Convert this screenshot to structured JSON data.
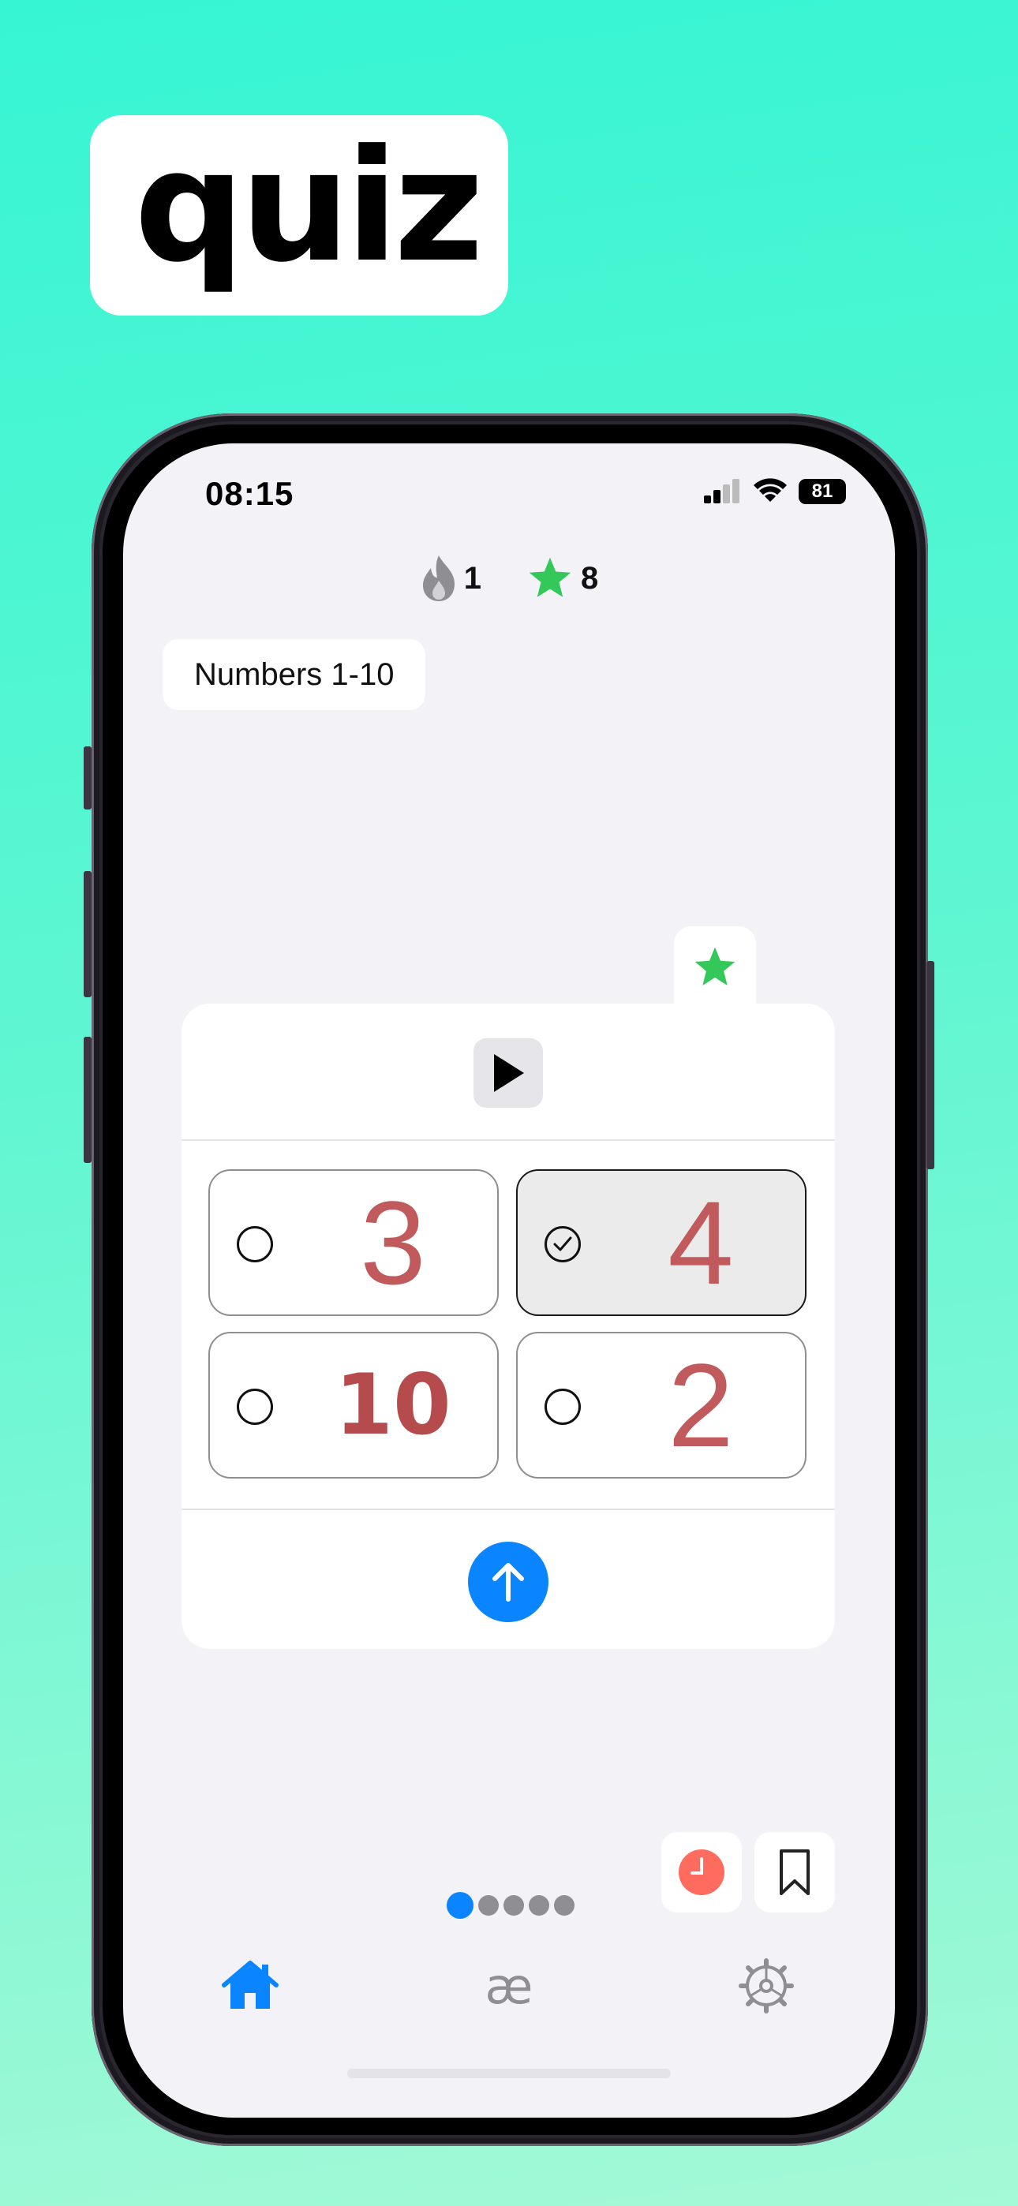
{
  "promo": {
    "title": "quiz"
  },
  "status_bar": {
    "time": "08:15",
    "battery": "81"
  },
  "stats": {
    "streak": "1",
    "stars": "8"
  },
  "deck": {
    "name": "Numbers 1-10"
  },
  "quiz": {
    "options": [
      {
        "label": "3",
        "selected": false
      },
      {
        "label": "4",
        "selected": true
      },
      {
        "label": "10",
        "selected": false
      },
      {
        "label": "2",
        "selected": false
      }
    ]
  },
  "pager": {
    "total": 5,
    "current": 1
  },
  "tab_bar": {
    "items": [
      {
        "icon": "house-icon",
        "active": true
      },
      {
        "label": "æ",
        "active": false
      },
      {
        "icon": "gear-icon",
        "active": false
      }
    ]
  },
  "colors": {
    "accent": "#0a84ff",
    "star": "#34c759",
    "answer_text": "#c15a5c",
    "timer": "#ff6b5e"
  }
}
